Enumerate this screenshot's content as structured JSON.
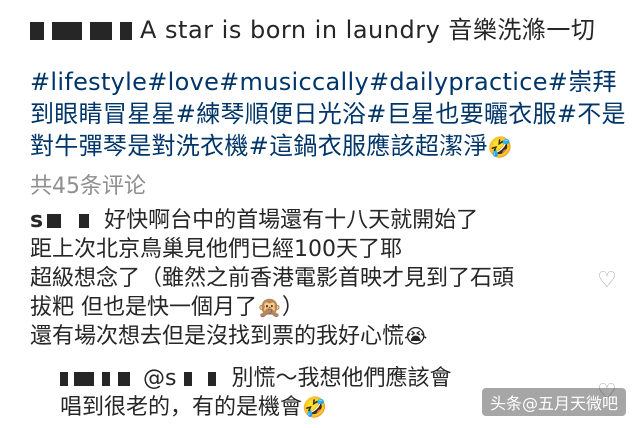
{
  "post": {
    "caption": "A star is born in laundry 音樂洗滌一切",
    "hashtags": "#lifestyle#love#musiccally#dailypractice#崇拜到眼睛冒星星#練琴順便日光浴#巨星也要曬衣服#不是對牛彈琴是對洗衣機#這鍋衣服應該超潔淨",
    "hashtags_emoji": "🤣"
  },
  "comments_count": "共45条评论",
  "comment": {
    "author_initial": "s",
    "line1": "好快啊台中的首場還有十八天就開始了",
    "line2": "距上次北京鳥巢見他們已經100天了耶",
    "line3": "超級想念了（雖然之前香港電影首映才見到了石頭",
    "line4": "拔粑 但也是快一個月了",
    "line4_emoji": "🙊",
    "line4_end": "）",
    "line5": "還有場次想去但是沒找到票的我好心慌",
    "line5_emoji": "😭"
  },
  "reply": {
    "mention_prefix": "@s",
    "line1": "別慌～我想他們應該會",
    "line2": "唱到很老的，有的是機會",
    "line2_emoji": "🤣"
  },
  "icons": {
    "like": "heart-outline-icon"
  },
  "watermark": "头条@五月天微吧"
}
